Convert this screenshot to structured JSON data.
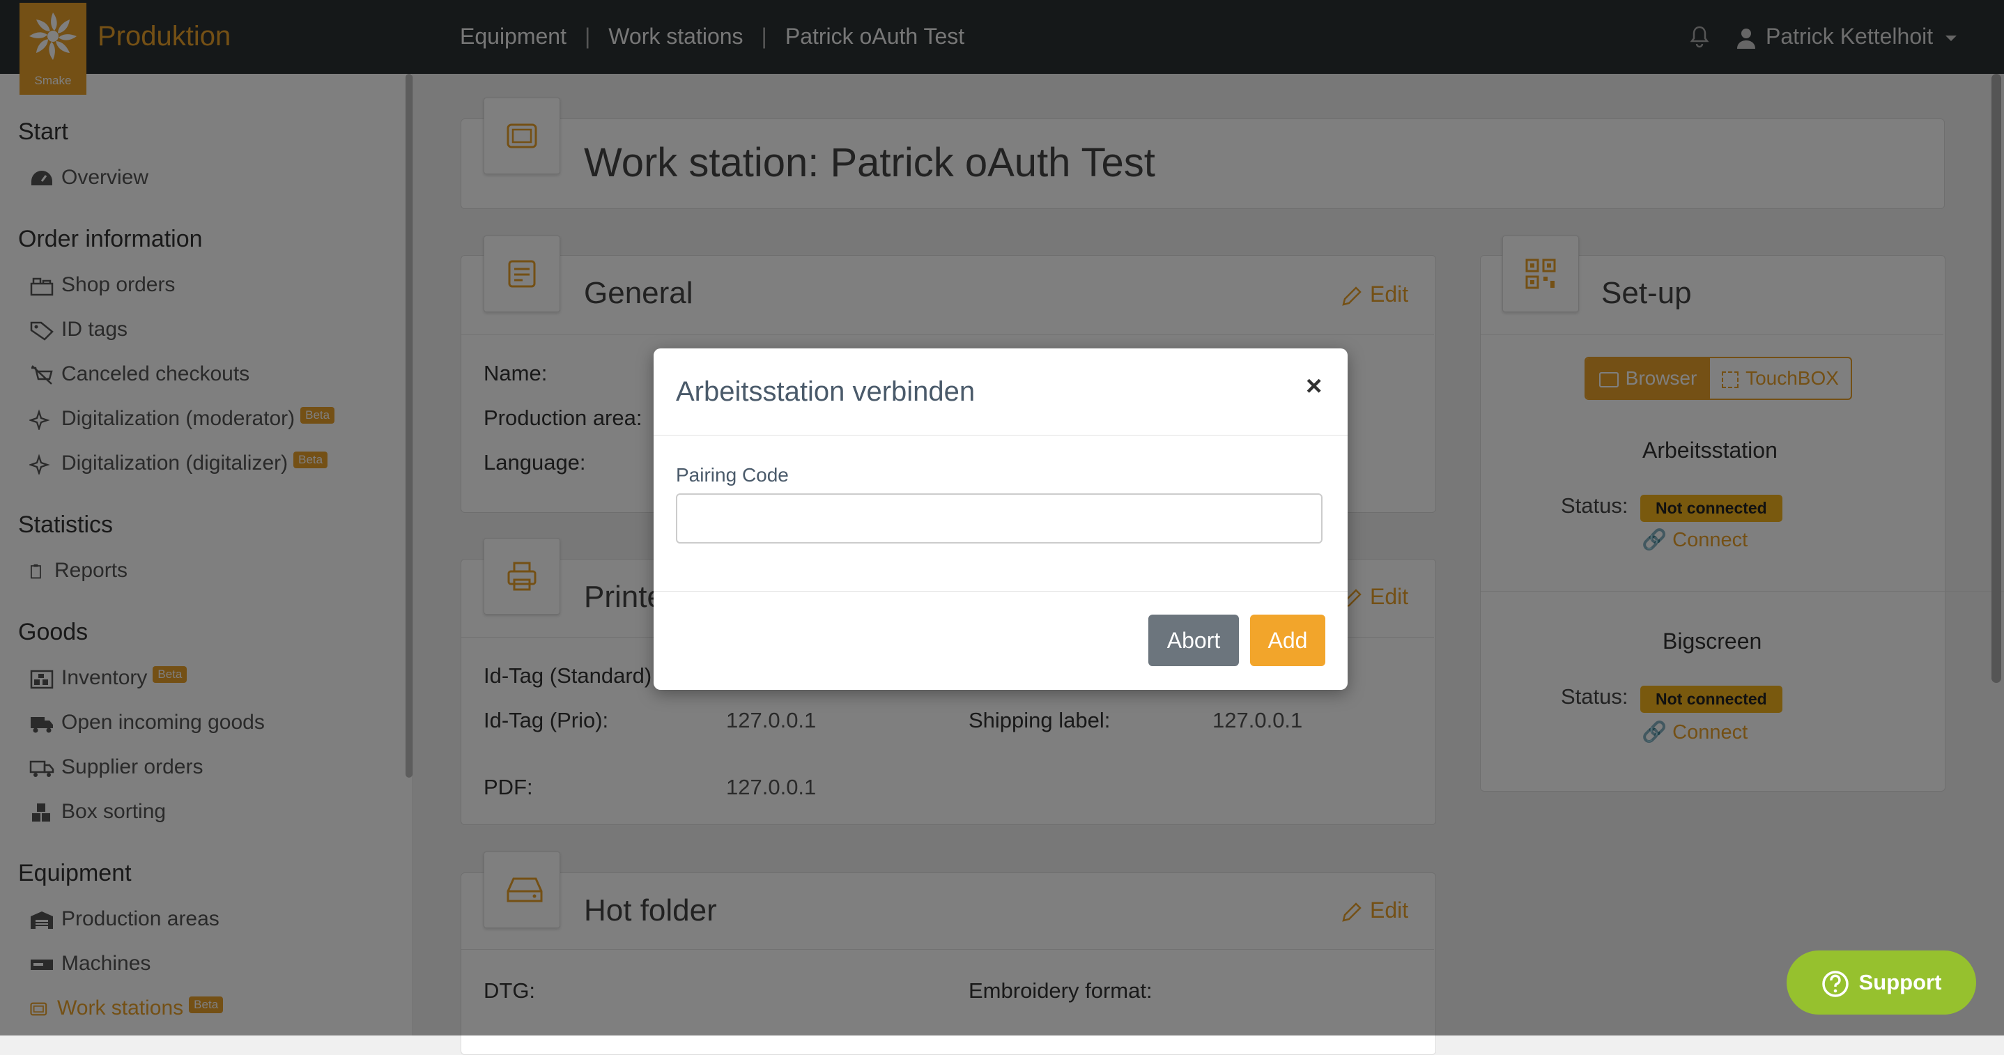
{
  "topbar": {
    "brand_small": "Smake",
    "brand_name": "Produktion",
    "breadcrumb": [
      "Equipment",
      "Work stations",
      "Patrick oAuth Test"
    ],
    "breadcrumb_sep": "|",
    "user_name": "Patrick Kettelhoit"
  },
  "sidebar": {
    "sections": {
      "start": "Start",
      "order": "Order information",
      "statistics": "Statistics",
      "goods": "Goods",
      "equipment": "Equipment"
    },
    "items": {
      "overview": "Overview",
      "shop_orders": "Shop orders",
      "id_tags": "ID tags",
      "canceled": "Canceled checkouts",
      "dig_moderator": "Digitalization (moderator)",
      "dig_digitalizer": "Digitalization (digitalizer)",
      "reports": "Reports",
      "inventory": "Inventory",
      "open_incoming": "Open incoming goods",
      "supplier_orders": "Supplier orders",
      "box_sorting": "Box sorting",
      "production_areas": "Production areas",
      "machines": "Machines",
      "work_stations": "Work stations"
    },
    "beta": "Beta"
  },
  "page": {
    "title": "Work station: Patrick oAuth Test",
    "edit": "Edit",
    "general": {
      "title": "General",
      "labels": [
        "Name:",
        "Production area:",
        "Language:"
      ]
    },
    "printer": {
      "title": "Printe",
      "id_tag_standard_label": "Id-Tag (Standard)",
      "id_tag_prio_label": "Id-Tag (Prio):",
      "id_tag_prio_value": "127.0.0.1",
      "shipping_label": "Shipping label:",
      "shipping_value": "127.0.0.1",
      "pdf_label": "PDF:",
      "pdf_value": "127.0.0.1"
    },
    "hotfolder": {
      "title": "Hot folder",
      "dtg": "DTG:",
      "embroidery": "Embroidery format:"
    },
    "setup": {
      "title": "Set-up",
      "tab_browser": "Browser",
      "tab_touchbox": "TouchBOX",
      "station1": "Arbeitsstation",
      "station2": "Bigscreen",
      "status_label": "Status:",
      "status_value": "Not connected",
      "connect": "Connect"
    }
  },
  "modal": {
    "title": "Arbeitsstation verbinden",
    "close": "×",
    "field_label": "Pairing Code",
    "field_value": "",
    "abort": "Abort",
    "add": "Add"
  },
  "support": "Support",
  "colors": {
    "accent": "#e9a02b",
    "topbar": "#2a3033",
    "badge": "#f2b21d",
    "support": "#96c12e"
  }
}
